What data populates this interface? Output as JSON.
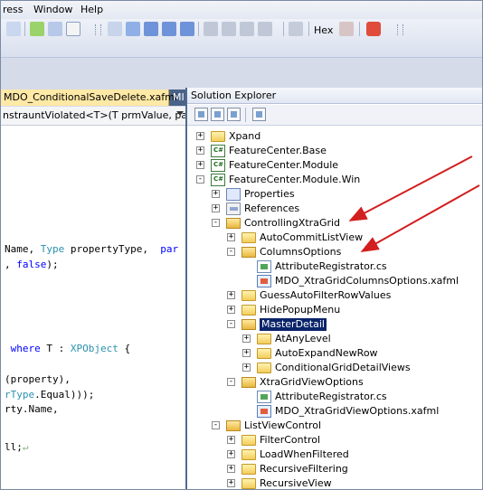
{
  "menu": {
    "items": [
      "ress",
      "Window",
      "Help"
    ]
  },
  "toolbar": {
    "hex_label": "Hex"
  },
  "editor": {
    "tabs": [
      "MDO_ConditionalSaveDelete.xafml",
      "MI"
    ],
    "signature": "nstrauntViolated<T>(T prmValue, params"
  },
  "code": [
    {
      "segments": [
        {
          "t": "Name, ",
          "c": ""
        },
        {
          "t": "Type",
          "c": "ty"
        },
        {
          "t": " propertyType,  ",
          "c": ""
        },
        {
          "t": "par",
          "c": "kw"
        }
      ]
    },
    {
      "segments": [
        {
          "t": ", ",
          "c": ""
        },
        {
          "t": "false",
          "c": "kw"
        },
        {
          "t": ");",
          "c": ""
        }
      ]
    },
    {
      "segments": [
        {
          "t": " ",
          "c": ""
        },
        {
          "t": "where",
          "c": "kw"
        },
        {
          "t": " T : ",
          "c": ""
        },
        {
          "t": "XPObject",
          "c": "ty"
        },
        {
          "t": " {",
          "c": ""
        }
      ]
    },
    {
      "segments": [
        {
          "t": "(property),",
          "c": ""
        }
      ]
    },
    {
      "segments": [
        {
          "t": "rType",
          "c": "ty"
        },
        {
          "t": ".Equal)));",
          "c": ""
        }
      ]
    },
    {
      "segments": [
        {
          "t": "rty.Name,",
          "c": ""
        }
      ]
    },
    {
      "segments": [
        {
          "t": "ll;",
          "c": ""
        },
        {
          "t": "↵",
          "c": "ret"
        }
      ]
    }
  ],
  "solution_explorer": {
    "title": "Solution Explorer",
    "tree": [
      {
        "label": "Xpand",
        "icon": "folder-icon",
        "exp": "+"
      },
      {
        "label": "FeatureCenter.Base",
        "icon": "csharp-project-icon",
        "exp": "+"
      },
      {
        "label": "FeatureCenter.Module",
        "icon": "csharp-project-icon",
        "exp": "+"
      },
      {
        "label": "FeatureCenter.Module.Win",
        "icon": "csharp-project-icon",
        "exp": "-"
      },
      {
        "label": "Properties",
        "icon": "properties-icon",
        "exp": "+"
      },
      {
        "label": "References",
        "icon": "references-icon",
        "exp": "+"
      },
      {
        "label": "ControllingXtraGrid",
        "icon": "folder-open-icon",
        "exp": "-"
      },
      {
        "label": "AutoCommitListView",
        "icon": "folder-icon",
        "exp": "+"
      },
      {
        "label": "ColumnsOptions",
        "icon": "folder-open-icon",
        "exp": "-"
      },
      {
        "label": "AttributeRegistrator.cs",
        "icon": "cs-file-icon",
        "exp": ""
      },
      {
        "label": "MDO_XtraGridColumnsOptions.xafml",
        "icon": "xafml-file-icon",
        "exp": ""
      },
      {
        "label": "GuessAutoFilterRowValues",
        "icon": "folder-icon",
        "exp": "+"
      },
      {
        "label": "HidePopupMenu",
        "icon": "folder-icon",
        "exp": "+"
      },
      {
        "label": "MasterDetail",
        "icon": "folder-open-icon",
        "exp": "-",
        "selected": true
      },
      {
        "label": "AtAnyLevel",
        "icon": "folder-icon",
        "exp": "+"
      },
      {
        "label": "AutoExpandNewRow",
        "icon": "folder-icon",
        "exp": "+"
      },
      {
        "label": "ConditionalGridDetailViews",
        "icon": "folder-icon",
        "exp": "+"
      },
      {
        "label": "XtraGridViewOptions",
        "icon": "folder-open-icon",
        "exp": "-"
      },
      {
        "label": "AttributeRegistrator.cs",
        "icon": "cs-file-icon",
        "exp": ""
      },
      {
        "label": "MDO_XtraGridViewOptions.xafml",
        "icon": "xafml-file-icon",
        "exp": ""
      },
      {
        "label": "ListViewControl",
        "icon": "folder-open-icon",
        "exp": "-"
      },
      {
        "label": "FilterControl",
        "icon": "folder-icon",
        "exp": "+"
      },
      {
        "label": "LoadWhenFiltered",
        "icon": "folder-icon",
        "exp": "+"
      },
      {
        "label": "RecursiveFiltering",
        "icon": "folder-icon",
        "exp": "+"
      },
      {
        "label": "RecursiveView",
        "icon": "folder-icon",
        "exp": "+"
      }
    ]
  },
  "colors": {
    "annotation_arrow": "#d21f1f",
    "selection": "#0a246a"
  }
}
